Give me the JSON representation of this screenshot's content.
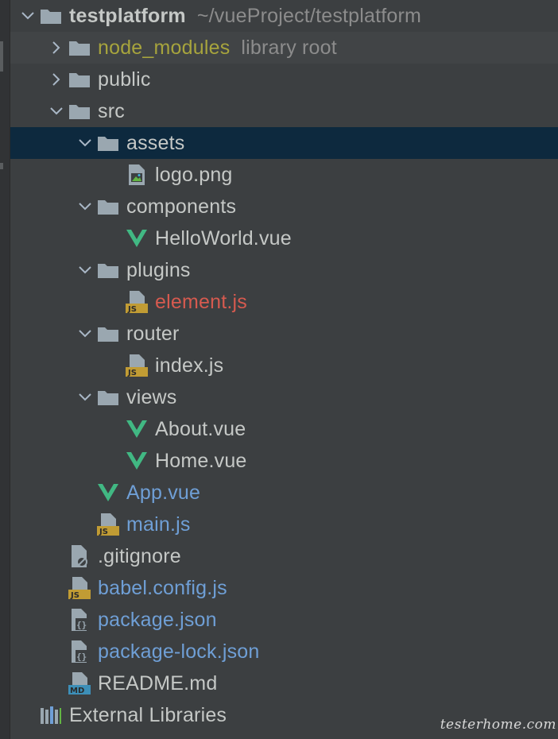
{
  "colors": {
    "background": "#3c3f41",
    "selection": "#0d293e",
    "text_default": "#c5c8c6",
    "text_modified": "#6f9fd6",
    "text_error": "#d65a4f",
    "text_excluded": "#a7a43d",
    "text_secondary": "#8c8c8c",
    "vue_green": "#41b883"
  },
  "tree": {
    "project": {
      "name": "testplatform",
      "path": "~/vueProject/testplatform"
    },
    "node_modules": {
      "name": "node_modules",
      "hint": "library root"
    },
    "public": {
      "name": "public"
    },
    "src": {
      "name": "src"
    },
    "assets": {
      "name": "assets"
    },
    "logo": {
      "name": "logo.png"
    },
    "components": {
      "name": "components"
    },
    "helloworld": {
      "name": "HelloWorld.vue"
    },
    "plugins": {
      "name": "plugins"
    },
    "element": {
      "name": "element.js"
    },
    "router": {
      "name": "router"
    },
    "router_index": {
      "name": "index.js"
    },
    "views": {
      "name": "views"
    },
    "about": {
      "name": "About.vue"
    },
    "home": {
      "name": "Home.vue"
    },
    "app": {
      "name": "App.vue"
    },
    "main": {
      "name": "main.js"
    },
    "gitignore": {
      "name": ".gitignore"
    },
    "babel": {
      "name": "babel.config.js"
    },
    "package": {
      "name": "package.json"
    },
    "package_lock": {
      "name": "package-lock.json"
    },
    "readme": {
      "name": "README.md"
    },
    "external": {
      "name": "External Libraries"
    }
  },
  "icons": {
    "folder": "folder-icon",
    "image": "image-file-icon",
    "vue": "vue-file-icon",
    "js": "js-file-icon",
    "json": "json-file-icon",
    "ignore": "ignore-file-icon",
    "markdown": "markdown-file-icon",
    "libraries": "libraries-icon"
  },
  "watermark": "testerhome.com"
}
